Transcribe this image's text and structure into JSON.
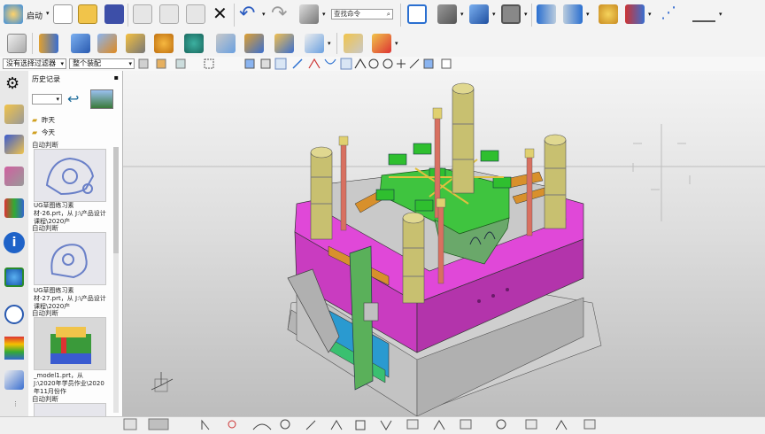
{
  "toolbar1": {
    "start_label": "启动",
    "command_search_placeholder": "查找命令"
  },
  "toolbar3": {
    "selection_filter": "没有选择过滤器",
    "assembly_scope": "整个装配"
  },
  "panel": {
    "title": "历史记录",
    "group_yesterday": "昨天",
    "group_today": "今天",
    "entries": [
      {
        "header": "自动判断",
        "caption": "UG草图练习素材-26.prt，从 J:\\产品设计课程\\2020产"
      },
      {
        "header": "自动判断",
        "caption": "UG草图练习素材-27.prt，从 J:\\产品设计课程\\2020产"
      },
      {
        "header": "自动判断",
        "caption": "_model1.prt，从 J:\\2020年学员作业\\2020年11月份作"
      },
      {
        "header": "自动判断",
        "caption": ""
      }
    ]
  },
  "colors": {
    "plate_magenta": "#e048d8",
    "base_gray": "#cfcfcf",
    "cavity_green": "#3fc43f",
    "pillar_khaki": "#c8c070",
    "accent_orange": "#d8902c"
  }
}
